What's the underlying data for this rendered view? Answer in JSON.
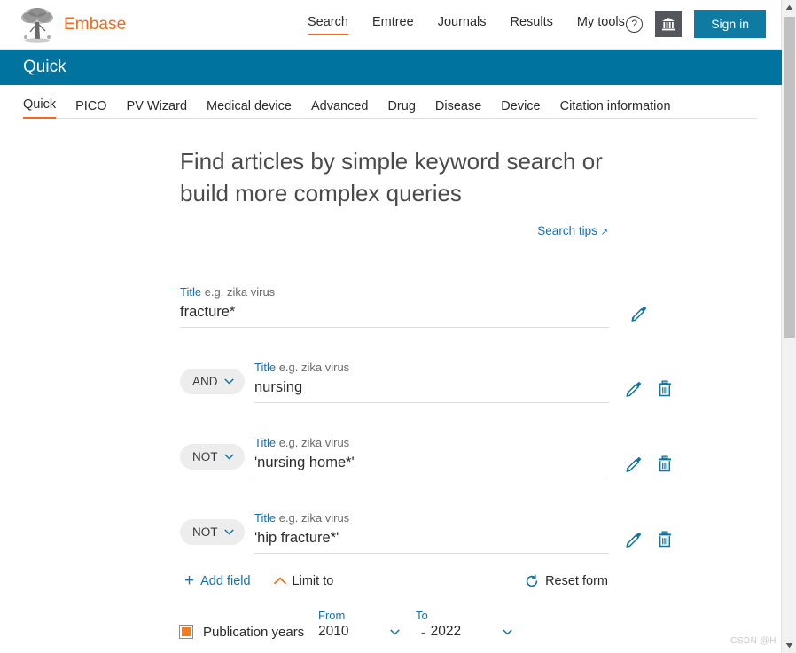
{
  "header": {
    "brand": "Embase",
    "brand_color": "#ef6b1f",
    "nav": [
      {
        "label": "Search",
        "active": true
      },
      {
        "label": "Emtree",
        "active": false
      },
      {
        "label": "Journals",
        "active": false
      },
      {
        "label": "Results",
        "active": false
      },
      {
        "label": "My tools",
        "active": false
      }
    ],
    "help_icon": "question-circle-icon",
    "institution_icon": "institution-icon",
    "sign_in": "Sign in",
    "accent_color": "#0f7ba3"
  },
  "banner": {
    "title": "Quick",
    "color": "#00739e"
  },
  "tabs": [
    {
      "label": "Quick",
      "active": true
    },
    {
      "label": "PICO",
      "active": false
    },
    {
      "label": "PV Wizard",
      "active": false
    },
    {
      "label": "Medical device",
      "active": false
    },
    {
      "label": "Advanced",
      "active": false
    },
    {
      "label": "Drug",
      "active": false
    },
    {
      "label": "Disease",
      "active": false
    },
    {
      "label": "Device",
      "active": false
    },
    {
      "label": "Citation information",
      "active": false
    }
  ],
  "main": {
    "title": "Find articles by simple keyword search or build more complex queries",
    "search_tips": "Search tips",
    "search_tips_arrow": "↗",
    "field_label_title": "Title",
    "field_label_example": "e.g. zika virus",
    "rows": [
      {
        "operator": null,
        "value": "fracture*",
        "has_delete": false
      },
      {
        "operator": "AND",
        "value": "nursing",
        "has_delete": true
      },
      {
        "operator": "NOT",
        "value": "'nursing home*'",
        "has_delete": true
      },
      {
        "operator": "NOT",
        "value": "'hip fracture*'",
        "has_delete": true
      }
    ],
    "actions": {
      "add_field": "Add field",
      "limit_to": "Limit to",
      "reset_form": "Reset form"
    },
    "publication_years": {
      "label": "Publication years",
      "checked": true,
      "check_color": "#f47b20",
      "from_label": "From",
      "to_label": "To",
      "from_value": "2010",
      "to_value": "2022",
      "separator": "-"
    }
  },
  "watermark": "CSDN @H",
  "icons": {
    "edit": "pencil-icon",
    "delete": "trash-icon",
    "add": "plus-icon",
    "collapse": "chevron-up-icon",
    "reset": "refresh-icon",
    "dropdown": "chevron-down-icon"
  }
}
